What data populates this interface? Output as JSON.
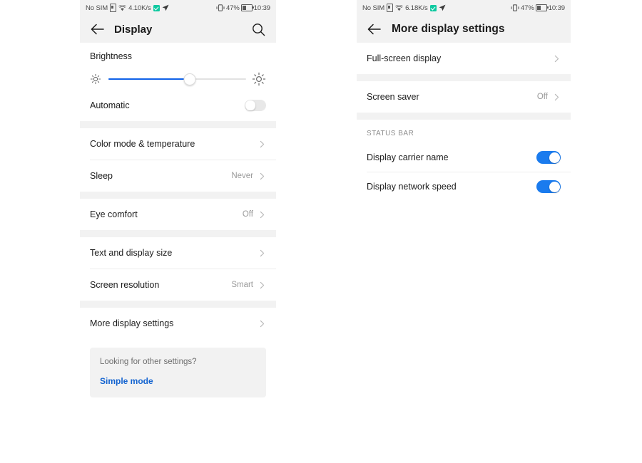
{
  "left_panel": {
    "status_bar": {
      "carrier": "No SIM",
      "sim_icon": "sim-card-icon",
      "wifi_icon": "wifi-icon",
      "network_speed": "4.10K/s",
      "app_icon": "green-check-app-icon",
      "location_icon": "navigation-arrow-icon",
      "vibrate_icon": "vibrate-mode-icon",
      "battery_percent": "47%",
      "battery_icon": "battery-icon",
      "clock": "10:39"
    },
    "toolbar": {
      "back_icon": "back-arrow-icon",
      "title": "Display",
      "search_icon": "search-icon"
    },
    "brightness": {
      "title": "Brightness",
      "low_icon": "brightness-low-sun-icon",
      "high_icon": "brightness-high-sun-icon",
      "value_percent": 59
    },
    "automatic": {
      "label": "Automatic",
      "state": "off"
    },
    "groups": [
      {
        "rows": [
          {
            "label": "Color mode & temperature",
            "value": "",
            "chevron": true
          }
        ]
      },
      {
        "rows": [
          {
            "label": "Sleep",
            "value": "Never",
            "chevron": true
          }
        ]
      },
      {
        "rows": [
          {
            "label": "Eye comfort",
            "value": "Off",
            "chevron": true
          }
        ]
      },
      {
        "rows": [
          {
            "label": "Text and display size",
            "value": "",
            "chevron": true
          },
          {
            "label": "Screen resolution",
            "value": "Smart",
            "chevron": true
          }
        ]
      },
      {
        "rows": [
          {
            "label": "More display settings",
            "value": "",
            "chevron": true
          }
        ]
      }
    ],
    "promo": {
      "question": "Looking for other settings?",
      "link": "Simple mode"
    }
  },
  "right_panel": {
    "status_bar": {
      "carrier": "No SIM",
      "sim_icon": "sim-card-icon",
      "wifi_icon": "wifi-icon",
      "network_speed": "6.18K/s",
      "app_icon": "green-check-app-icon",
      "location_icon": "navigation-arrow-icon",
      "vibrate_icon": "vibrate-mode-icon",
      "battery_percent": "47%",
      "battery_icon": "battery-icon",
      "clock": "10:39"
    },
    "toolbar": {
      "back_icon": "back-arrow-icon",
      "title": "More display settings"
    },
    "groups": [
      {
        "rows": [
          {
            "label": "Full-screen display",
            "value": "",
            "chevron": true
          }
        ]
      },
      {
        "rows": [
          {
            "label": "Screen saver",
            "value": "Off",
            "chevron": true
          }
        ]
      }
    ],
    "status_bar_section": {
      "header": "STATUS BAR",
      "rows": [
        {
          "label": "Display carrier name",
          "state": "on"
        },
        {
          "label": "Display network speed",
          "state": "on"
        }
      ]
    }
  },
  "colors": {
    "accent_blue": "#1a7bee",
    "slider_blue": "#1062e8",
    "link_blue": "#1363d0",
    "band_grey": "#f2f2f2",
    "toggle_off_grey": "#e8e8e8",
    "green_badge": "#0ec9a0"
  }
}
